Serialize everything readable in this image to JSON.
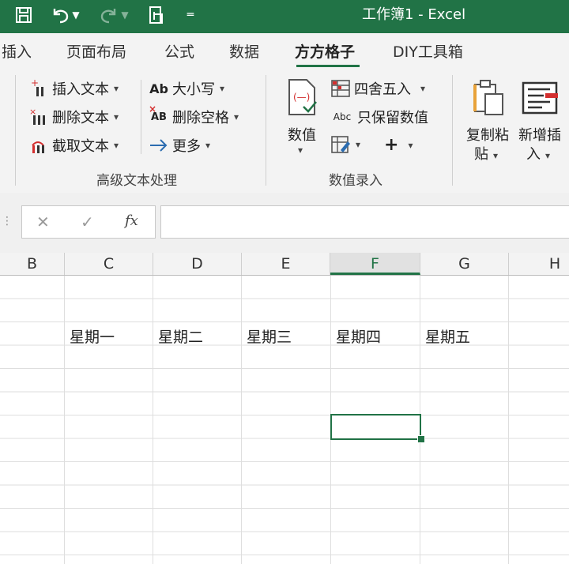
{
  "window": {
    "title": "工作簿1  -  Excel"
  },
  "colors": {
    "excel_green": "#217346",
    "ribbon_bg": "#f3f3f3"
  },
  "quick_access": {
    "icons": [
      "save-icon",
      "undo-icon",
      "redo-icon",
      "touch-mode-icon",
      "customize-icon"
    ]
  },
  "tabs": [
    {
      "label": "插入"
    },
    {
      "label": "页面布局"
    },
    {
      "label": "公式"
    },
    {
      "label": "数据"
    },
    {
      "label": "方方格子",
      "active": true
    },
    {
      "label": "DIY工具箱"
    }
  ],
  "ribbon": {
    "text_group": {
      "label": "高级文本处理",
      "insert_text": "插入文本",
      "delete_text": "删除文本",
      "extract_text": "截取文本",
      "case": "大小写",
      "case_icon_text": "Ab",
      "delete_spaces": "删除空格",
      "delete_spaces_icon_text": "AB",
      "more": "更多"
    },
    "number_group": {
      "label": "数值录入",
      "value_line1": "数值",
      "round": "四舍五入",
      "keep_values": "只保留数值",
      "keep_values_icon_text": "Abc"
    },
    "paste_group": {
      "copy_paste_line1": "复制粘",
      "copy_paste_line2": "贴",
      "new_insert_line1": "新增插",
      "new_insert_line2": "入"
    }
  },
  "formula_bar": {
    "fx_label": "fx",
    "value": ""
  },
  "columns": [
    "B",
    "C",
    "D",
    "E",
    "F",
    "G",
    "H"
  ],
  "selected_column": "F",
  "cells": {
    "row_values": [
      "星期一",
      "星期二",
      "星期三",
      "星期四",
      "星期五"
    ]
  }
}
